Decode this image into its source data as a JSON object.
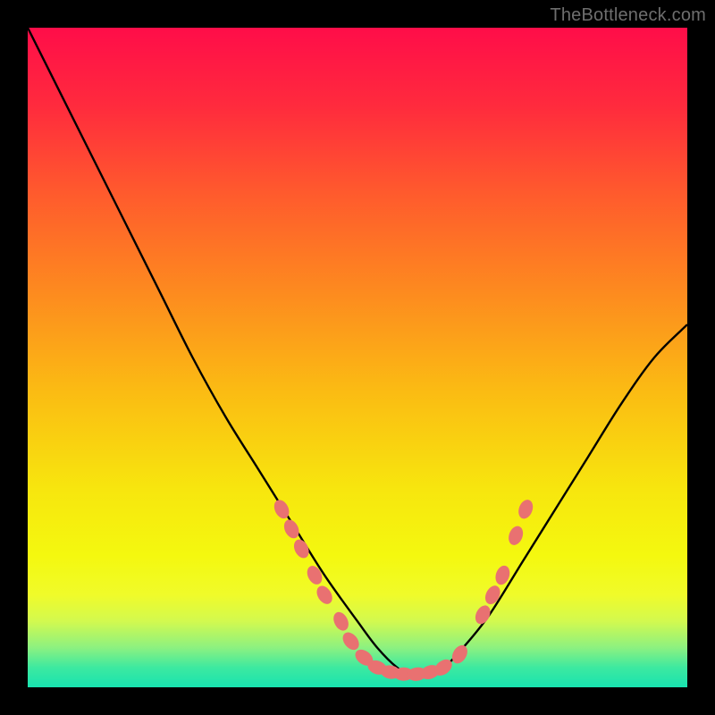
{
  "watermark": "TheBottleneck.com",
  "chart_data": {
    "type": "line",
    "title": "",
    "xlabel": "",
    "ylabel": "",
    "xlim": [
      0,
      100
    ],
    "ylim": [
      0,
      100
    ],
    "grid": false,
    "series": [
      {
        "name": "curve",
        "color": "#000000",
        "x": [
          0,
          5,
          10,
          15,
          20,
          25,
          30,
          35,
          40,
          45,
          50,
          53,
          56,
          58,
          60,
          63,
          66,
          70,
          75,
          80,
          85,
          90,
          95,
          100
        ],
        "y": [
          100,
          90,
          80,
          70,
          60,
          50,
          41,
          33,
          25,
          17,
          10,
          6,
          3,
          2,
          2,
          3,
          6,
          11,
          19,
          27,
          35,
          43,
          50,
          55
        ]
      }
    ],
    "highlight_points": {
      "name": "markers",
      "color": "#e97171",
      "points": [
        {
          "x": 38.5,
          "y": 27
        },
        {
          "x": 40.0,
          "y": 24
        },
        {
          "x": 41.5,
          "y": 21
        },
        {
          "x": 43.5,
          "y": 17
        },
        {
          "x": 45.0,
          "y": 14
        },
        {
          "x": 47.5,
          "y": 10
        },
        {
          "x": 49.0,
          "y": 7
        },
        {
          "x": 51.0,
          "y": 4.5
        },
        {
          "x": 53.0,
          "y": 3
        },
        {
          "x": 55.0,
          "y": 2.3
        },
        {
          "x": 57.0,
          "y": 2
        },
        {
          "x": 59.0,
          "y": 2
        },
        {
          "x": 61.0,
          "y": 2.3
        },
        {
          "x": 63.0,
          "y": 3
        },
        {
          "x": 65.5,
          "y": 5
        },
        {
          "x": 69.0,
          "y": 11
        },
        {
          "x": 70.5,
          "y": 14
        },
        {
          "x": 72.0,
          "y": 17
        },
        {
          "x": 74.0,
          "y": 23
        },
        {
          "x": 75.5,
          "y": 27
        }
      ]
    },
    "gradient_stops": [
      {
        "offset": 0.0,
        "color": "#ff0d49"
      },
      {
        "offset": 0.12,
        "color": "#ff2b3d"
      },
      {
        "offset": 0.25,
        "color": "#ff5a2d"
      },
      {
        "offset": 0.4,
        "color": "#fd8a1f"
      },
      {
        "offset": 0.55,
        "color": "#fbbb13"
      },
      {
        "offset": 0.7,
        "color": "#f7e60e"
      },
      {
        "offset": 0.8,
        "color": "#f4f80f"
      },
      {
        "offset": 0.86,
        "color": "#f0fb2a"
      },
      {
        "offset": 0.9,
        "color": "#d2f94f"
      },
      {
        "offset": 0.94,
        "color": "#8cf180"
      },
      {
        "offset": 0.97,
        "color": "#3de9a0"
      },
      {
        "offset": 1.0,
        "color": "#18e3b0"
      }
    ]
  }
}
